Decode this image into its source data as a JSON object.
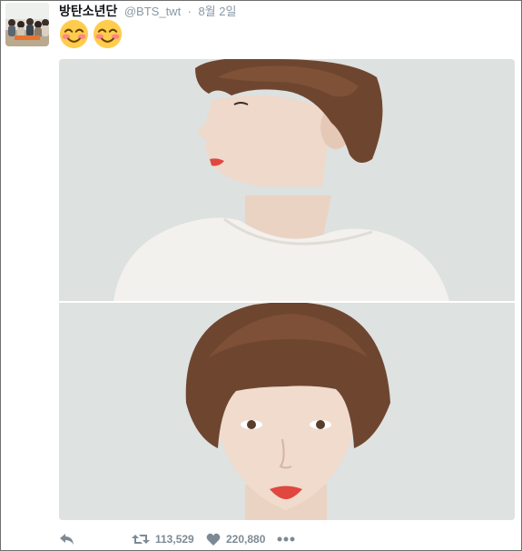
{
  "tweet": {
    "display_name": "방탄소년단",
    "handle": "@BTS_twt",
    "separator": "·",
    "timestamp": "8월 2일",
    "text_emojis": [
      "smiling-face-with-smiling-eyes",
      "smiling-face-with-smiling-eyes"
    ]
  },
  "media": {
    "photos": [
      {
        "description_icon": "portrait-profile-photo"
      },
      {
        "description_icon": "portrait-front-photo"
      }
    ]
  },
  "actions": {
    "reply_icon": "reply-icon",
    "retweet_icon": "retweet-icon",
    "retweet_count": "113,529",
    "like_icon": "heart-icon",
    "like_count": "220,880",
    "more_icon": "more-icon"
  },
  "colors": {
    "text_primary": "#14171a",
    "text_secondary": "#8899a6",
    "action_gray": "#7d8a95",
    "photo_background": "#dfe2e1",
    "hair": "#6e4630",
    "lips": "#e0473f"
  }
}
